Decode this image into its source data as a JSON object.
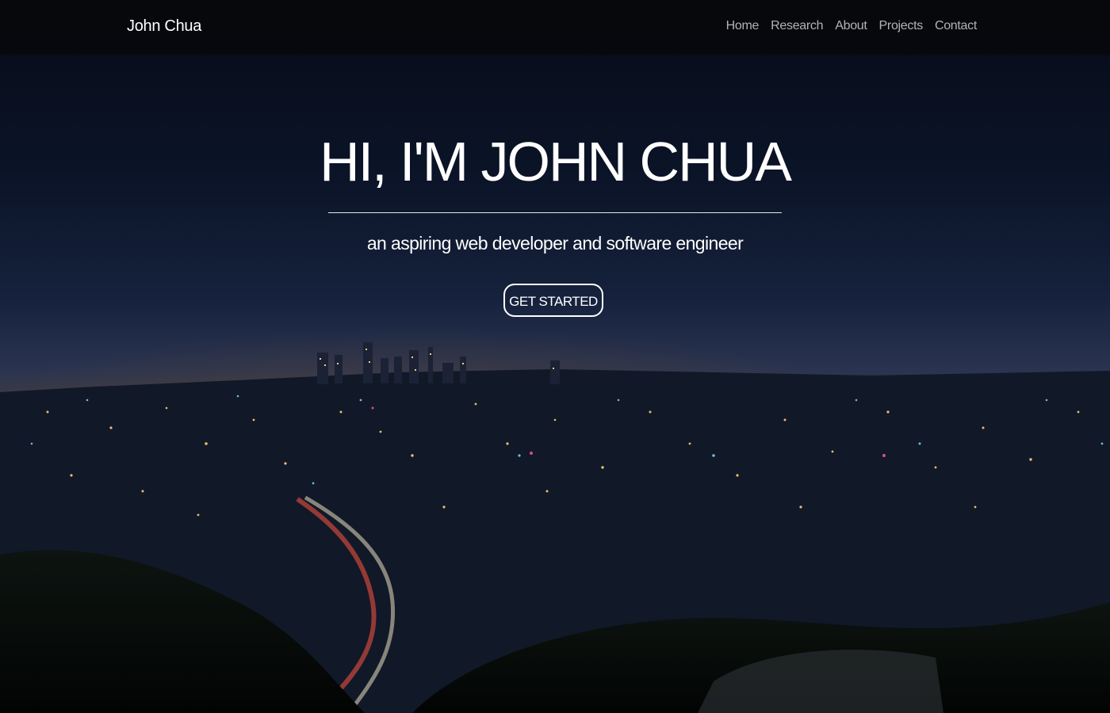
{
  "navbar": {
    "brand": "John Chua",
    "links": [
      {
        "label": "Home"
      },
      {
        "label": "Research"
      },
      {
        "label": "About"
      },
      {
        "label": "Projects"
      },
      {
        "label": "Contact"
      }
    ]
  },
  "hero": {
    "title": "HI, I'M JOHN CHUA",
    "subtitle": "an aspiring web developer and software engineer",
    "cta_label": "GET STARTED",
    "background": "night-city-skyline-photo"
  },
  "colors": {
    "navbar_bg": "#08090c",
    "nav_link": "#b3b3b3",
    "text": "#ffffff",
    "sky_top": "#0b1326",
    "sky_horizon": "#1e2d4a"
  }
}
